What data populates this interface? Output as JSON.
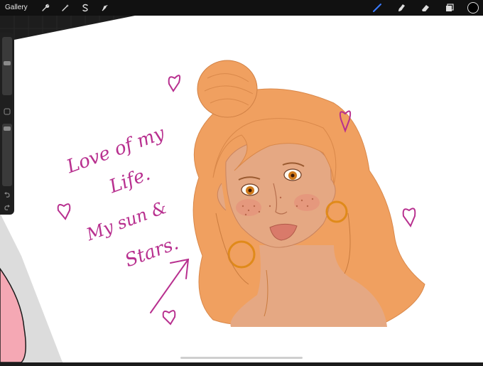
{
  "toolbar": {
    "gallery_label": "Gallery",
    "left_tools": [
      "wrench-icon",
      "magic-wand-icon",
      "selection-s-icon",
      "transform-arrow-icon"
    ],
    "right_tools": [
      "brush-icon",
      "smudge-icon",
      "eraser-icon",
      "layers-icon"
    ],
    "active_tool": "brush-icon",
    "active_tool_color": "#3a7bff",
    "current_color": "#000000"
  },
  "canvas": {
    "lettering": [
      "Love of my",
      "Life.",
      "My sun &",
      "Stars."
    ],
    "lettering_color": "#b8308f",
    "hair_color": "#f0a060",
    "skin_color": "#e5a883",
    "earring_color": "#e08a1a"
  },
  "sidebar": {
    "tools": [
      "brush-size-slider",
      "modify-button",
      "opacity-slider",
      "undo-icon",
      "redo-icon"
    ]
  }
}
